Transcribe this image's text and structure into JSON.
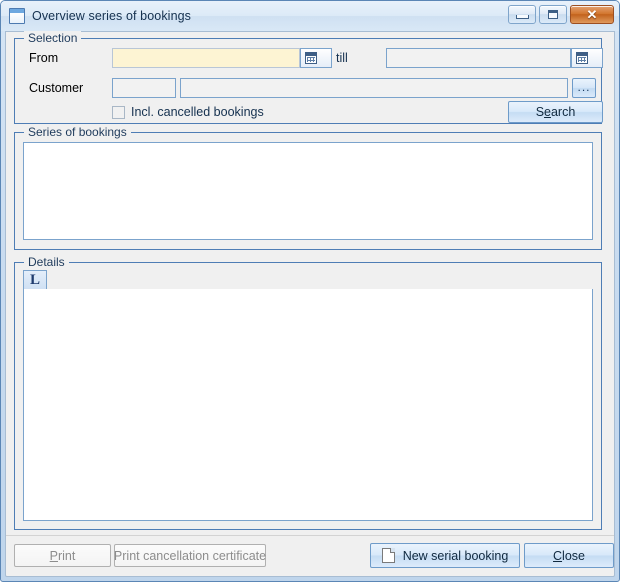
{
  "window": {
    "title": "Overview series of bookings",
    "icon": "window-icon",
    "controls": {
      "minimize": "minimize-button",
      "maximize": "maximize-button",
      "close": "close-button",
      "close_glyph": "✕"
    },
    "colors": {
      "frame_border": "#5b86b5",
      "titlebar_start": "#e8f1fa",
      "client_bg": "#f0f0f0",
      "group_border": "#4e7db5",
      "input_border": "#7ba3cc",
      "highlight_field_bg": "#fdf4d3",
      "close_button_bg": "#d2762f",
      "accent_text": "#1f3b5c"
    }
  },
  "selection": {
    "group_title": "Selection",
    "from": {
      "label": "From",
      "value": "",
      "placeholder": "",
      "dropdown_icon": "calendar-icon"
    },
    "till": {
      "label": "till",
      "value": "",
      "placeholder": "",
      "dropdown_icon": "calendar-icon"
    },
    "customer": {
      "label": "Customer",
      "id_value": "",
      "id_placeholder": "",
      "name_value": "",
      "name_placeholder": "",
      "browse_label": "..."
    },
    "incl_cancelled": {
      "label": "Incl. cancelled bookings",
      "checked": false
    },
    "search_button": {
      "prefix": "S",
      "accel": "e",
      "suffix": "arch"
    }
  },
  "series": {
    "group_title": "Series of bookings",
    "rows": []
  },
  "details": {
    "group_title": "Details",
    "tab_label": "L",
    "rows": []
  },
  "footer": {
    "print": {
      "accel": "P",
      "suffix": "rint",
      "disabled": true
    },
    "print_cancellation": {
      "label": "Print cancellation certificate",
      "disabled": true
    },
    "new_serial_booking": {
      "label": "New serial booking",
      "icon": "page-icon",
      "disabled": false
    },
    "close": {
      "accel": "C",
      "suffix": "lose",
      "disabled": false
    }
  }
}
